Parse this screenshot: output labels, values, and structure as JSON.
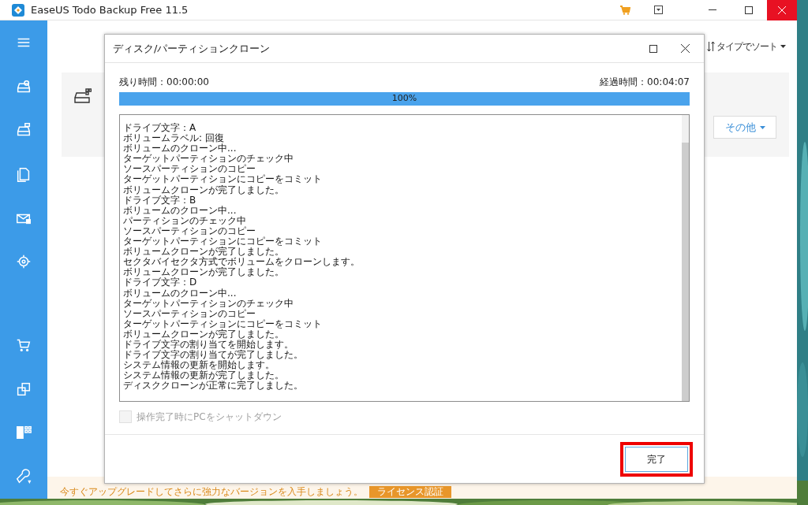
{
  "window": {
    "title": "EaseUS Todo Backup Free 11.5"
  },
  "main": {
    "sort_label": "タイプでソート",
    "more_button": "その他"
  },
  "banner": {
    "text": "今すぐアップグレードしてさらに強力なバージョンを入手しましょう。",
    "button": "ライセンス認証"
  },
  "dialog": {
    "title": "ディスク/パーティションクローン",
    "remaining": {
      "label": "残り時間：",
      "value": "00:00:00"
    },
    "elapsed": {
      "label": "経過時間：",
      "value": "00:04:07"
    },
    "progress": {
      "level": 1,
      "text": "100%"
    },
    "log": [
      "ドライブ文字：A",
      "ボリュームラベル: 回復",
      "ボリュームのクローン中...",
      "ターゲットパーティションのチェック中",
      "ソースパーティションのコピー",
      "ターゲットパーティションにコピーをコミット",
      "ボリュームクローンが完了しました。",
      "ドライブ文字：B",
      "ボリュームのクローン中...",
      "パーティションのチェック中",
      "ソースパーティションのコピー",
      "ターゲットパーティションにコピーをコミット",
      "ボリュームクローンが完了しました。",
      "セクタバイセクタ方式でボリュームをクローンします。",
      "ボリュームクローンが完了しました。",
      "ドライブ文字：D",
      "ボリュームのクローン中...",
      "ターゲットパーティションのチェック中",
      "ソースパーティションのコピー",
      "ターゲットパーティションにコピーをコミット",
      "ボリュームクローンが完了しました。",
      "ドライブ文字の割り当てを開始します。",
      "ドライブ文字の割り当てが完了しました。",
      "システム情報の更新を開始します。",
      "システム情報の更新が完了しました。",
      "ディスククローンが正常に完了しました。"
    ],
    "shutdown": {
      "label": "操作完了時にPCをシャットダウン",
      "checked": false,
      "disabled": true
    },
    "finish": {
      "label": "完了",
      "highlighted": true
    }
  }
}
